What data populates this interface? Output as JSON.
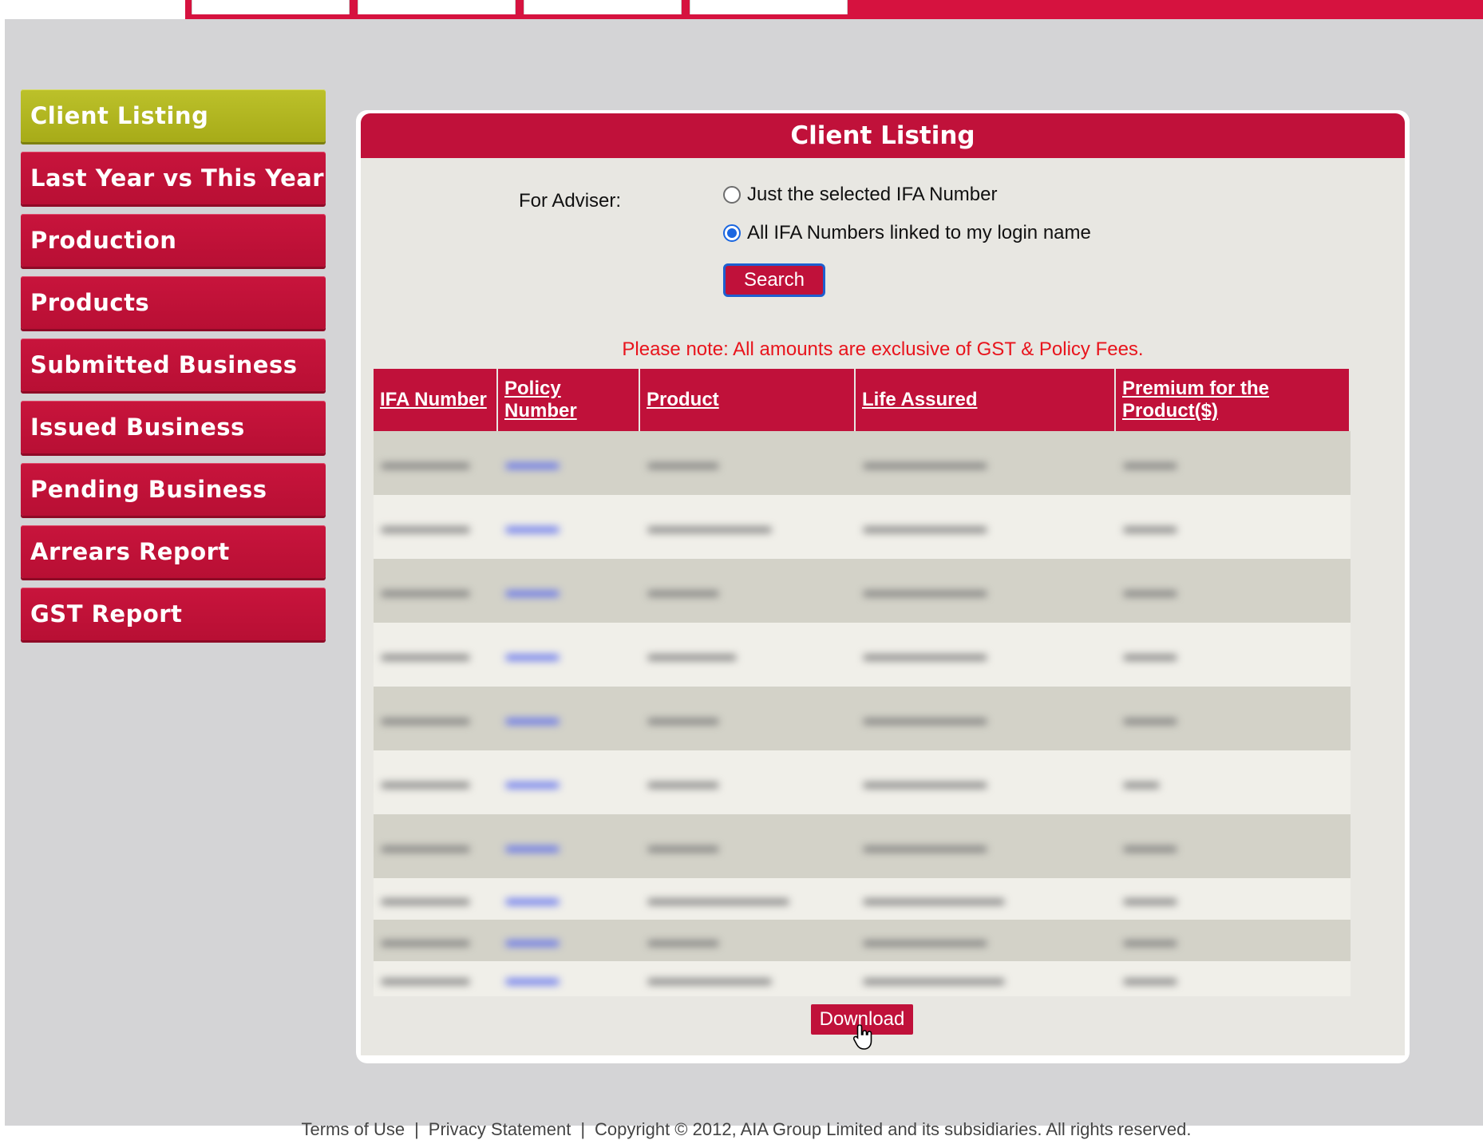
{
  "sidebar": {
    "items": [
      {
        "label": "Client Listing",
        "active": true
      },
      {
        "label": "Last Year vs This Year"
      },
      {
        "label": "Production"
      },
      {
        "label": "Products"
      },
      {
        "label": "Submitted Business"
      },
      {
        "label": "Issued Business"
      },
      {
        "label": "Pending Business"
      },
      {
        "label": "Arrears Report"
      },
      {
        "label": "GST Report"
      }
    ]
  },
  "panel": {
    "title": "Client Listing",
    "adviser_label": "For Adviser:",
    "radio_options": [
      {
        "label": "Just the selected IFA Number",
        "checked": false
      },
      {
        "label": "All IFA Numbers linked to my login name",
        "checked": true
      }
    ],
    "search_label": "Search",
    "note": "Please note: All amounts are exclusive of GST & Policy Fees.",
    "table": {
      "headers": [
        "IFA Number",
        "Policy Number",
        "Product",
        "Life Assured",
        "Premium for the Product($)"
      ]
    },
    "download_label": "Download"
  },
  "footer": {
    "terms": "Terms of Use",
    "sep1": "|",
    "privacy": "Privacy Statement",
    "sep2": "|",
    "copyright": "Copyright © 2012, AIA Group Limited and its subsidiaries. All rights reserved."
  },
  "colors": {
    "brand_red": "#c0113a",
    "active_green": "#b2b623",
    "note_red": "#e8141c"
  }
}
